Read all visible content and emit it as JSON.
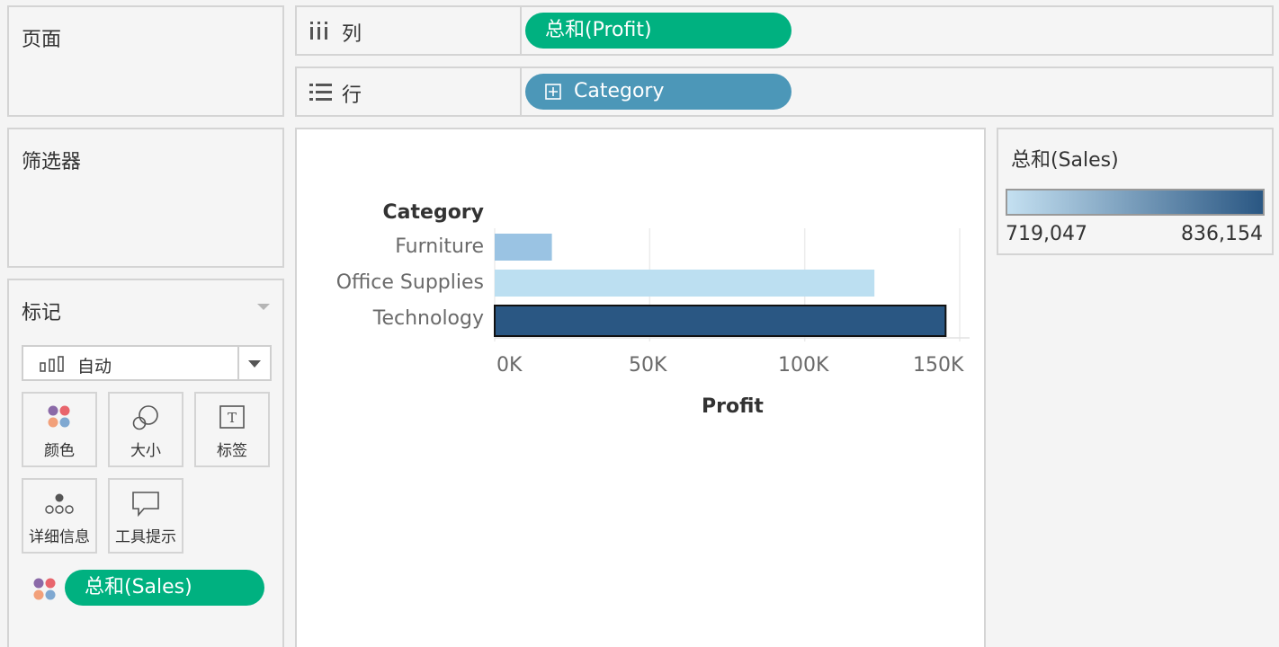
{
  "left_panels": {
    "pages_title": "页面",
    "filters_title": "筛选器",
    "marks": {
      "title": "标记",
      "mark_type": "自动",
      "cards": [
        {
          "label": "颜色",
          "icon": "color-dots-icon"
        },
        {
          "label": "大小",
          "icon": "size-circles-icon"
        },
        {
          "label": "标签",
          "icon": "text-label-icon"
        },
        {
          "label": "详细信息",
          "icon": "detail-dots-icon"
        },
        {
          "label": "工具提示",
          "icon": "tooltip-bubble-icon"
        }
      ],
      "field_pill": "总和(Sales)"
    }
  },
  "shelves": {
    "columns_label": "列",
    "columns_pill": "总和(Profit)",
    "rows_label": "行",
    "rows_pill": "Category",
    "rows_pill_icon": "plus-box-icon"
  },
  "legend": {
    "title": "总和(Sales)",
    "min_label": "719,047",
    "max_label": "836,154",
    "color_start": "#c4e0f1",
    "color_end": "#2a5783"
  },
  "chart_data": {
    "type": "bar",
    "orientation": "horizontal",
    "row_header": "Category",
    "categories": [
      "Furniture",
      "Office Supplies",
      "Technology"
    ],
    "values": [
      18451,
      122491,
      145455
    ],
    "colors": [
      "#9ac3e3",
      "#bcdff1",
      "#2a5783"
    ],
    "xlabel": "Profit",
    "xticks": [
      "0K",
      "50K",
      "100K",
      "150K"
    ],
    "xlim": [
      0,
      150000
    ]
  }
}
